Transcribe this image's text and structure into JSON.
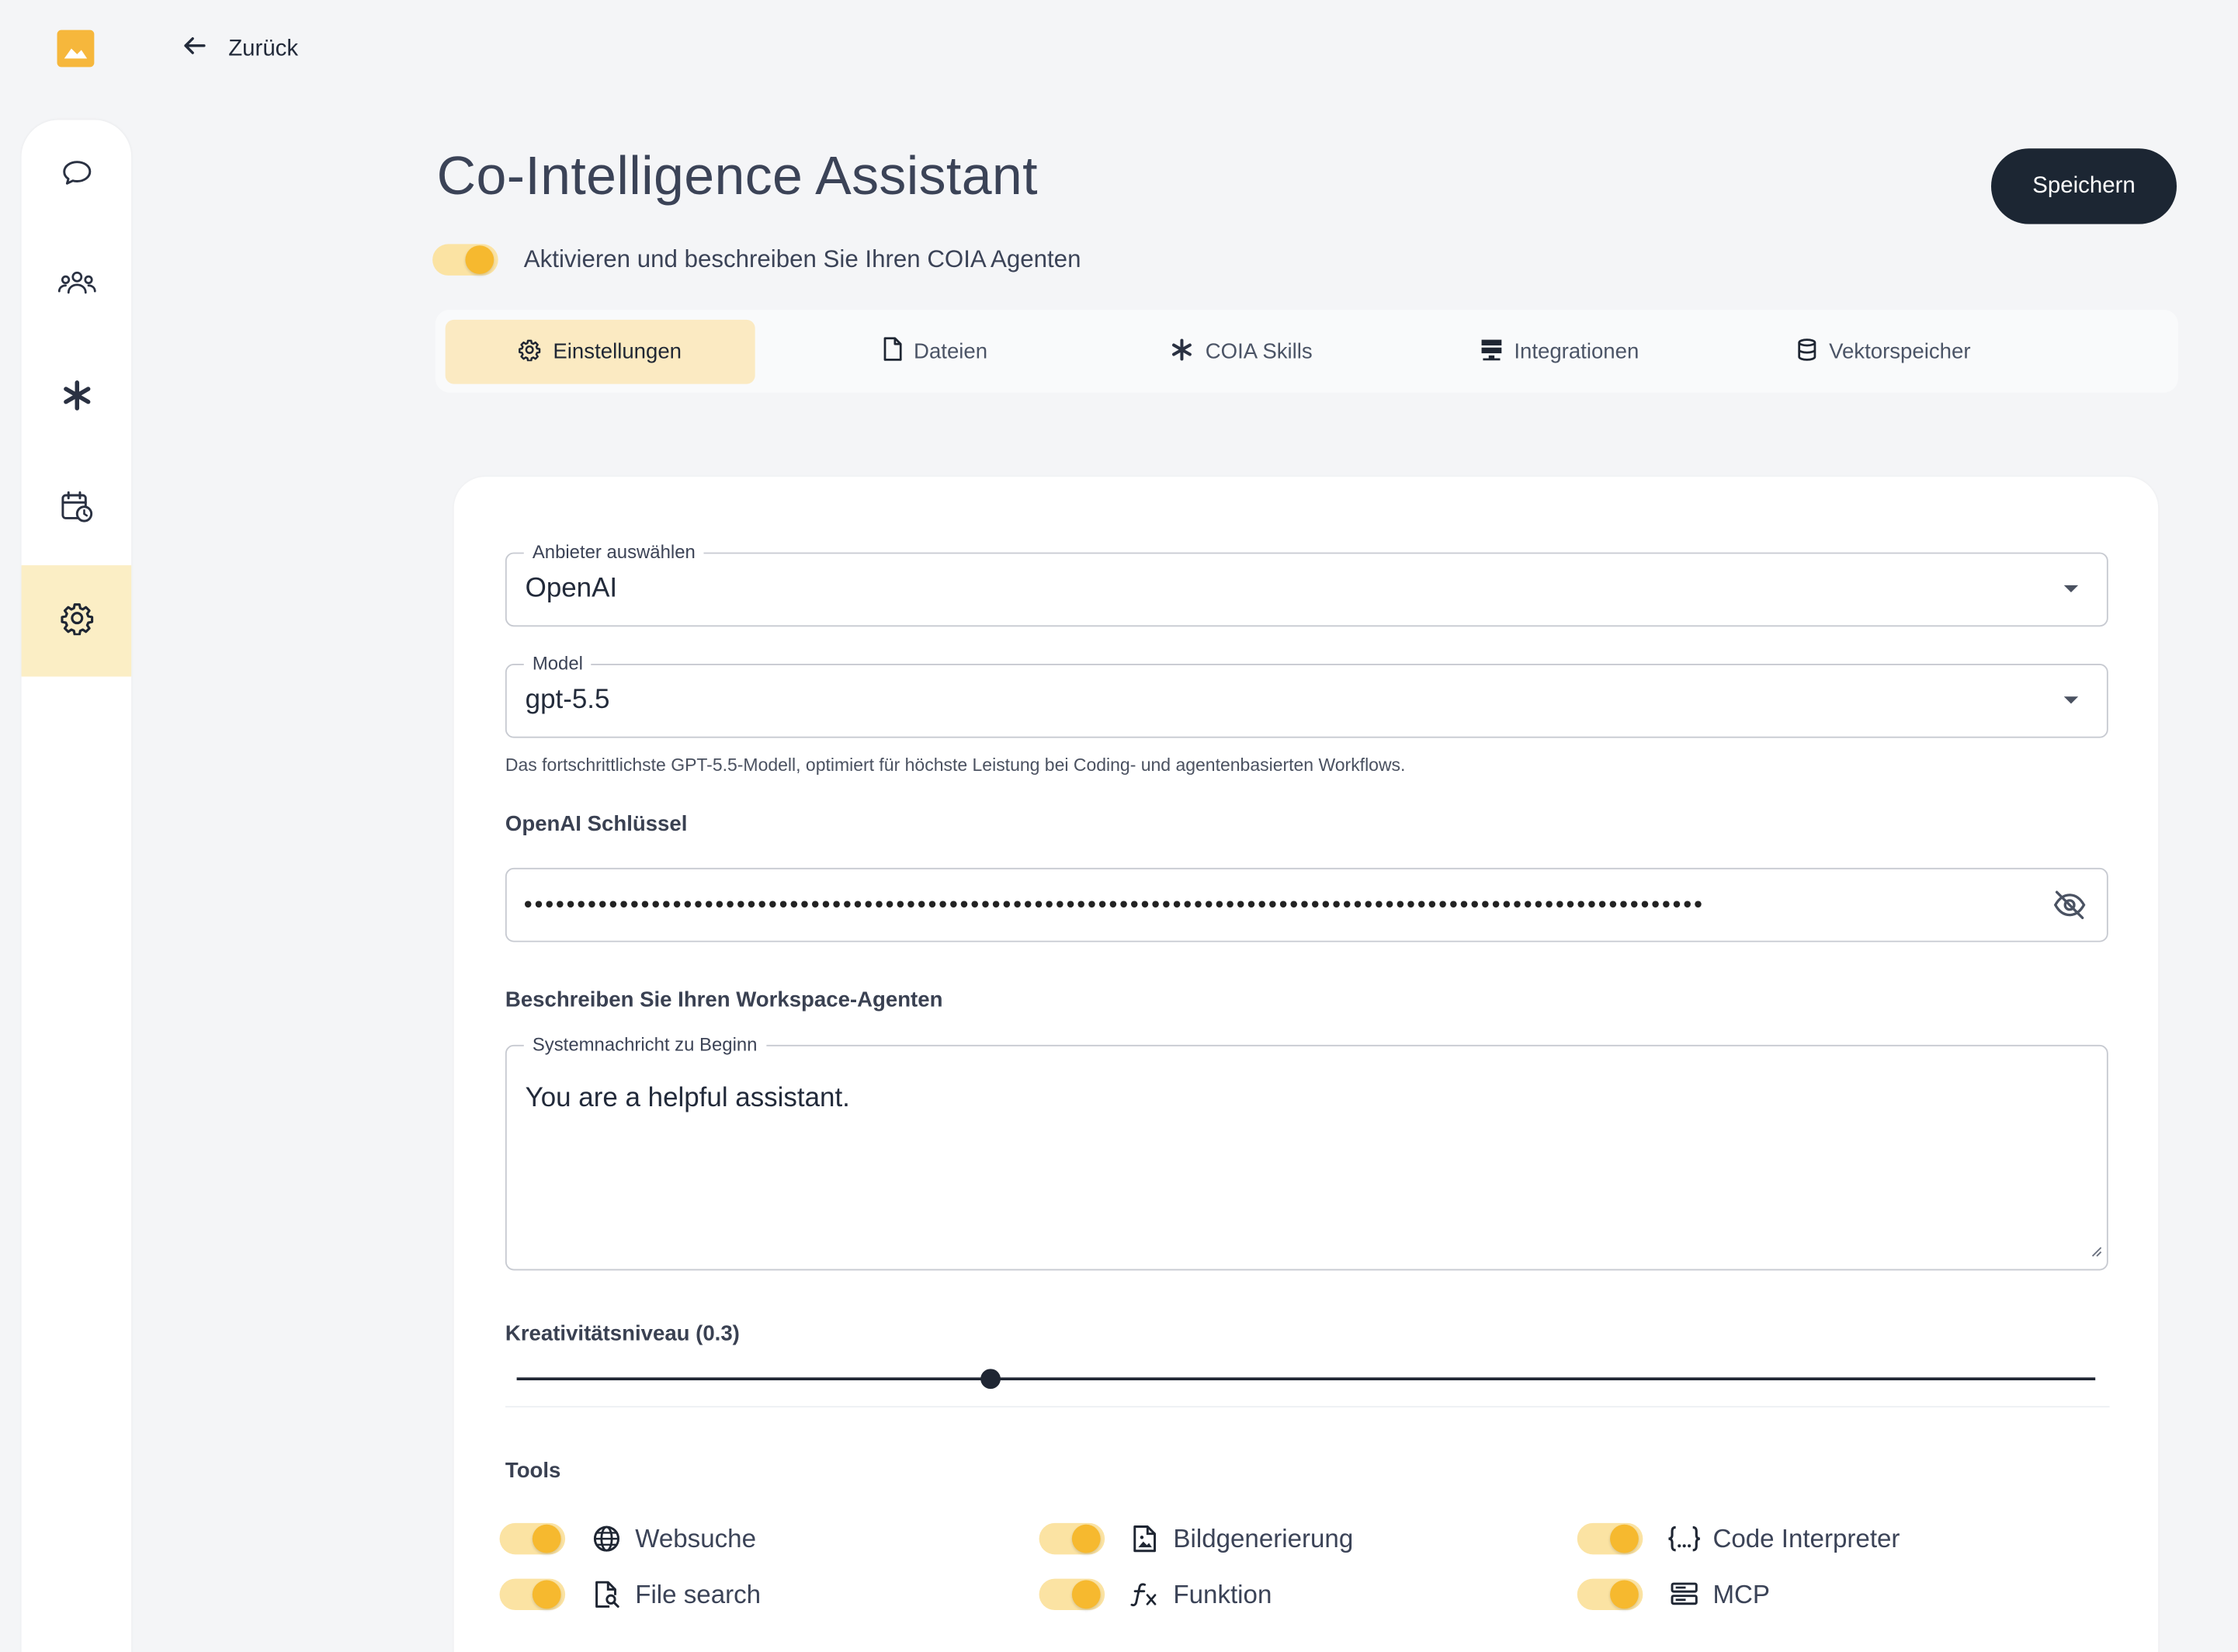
{
  "nav": {
    "back_label": "Zurück"
  },
  "sidebar": {
    "items": [
      {
        "name": "chat",
        "icon": "chat-bubble-icon"
      },
      {
        "name": "users",
        "icon": "users-icon"
      },
      {
        "name": "skills",
        "icon": "asterisk-icon"
      },
      {
        "name": "schedule",
        "icon": "calendar-clock-icon"
      },
      {
        "name": "settings",
        "icon": "gear-icon",
        "active": true
      }
    ]
  },
  "header": {
    "title": "Co-Intelligence Assistant",
    "save_label": "Speichern",
    "activate_label": "Aktivieren und beschreiben Sie Ihren COIA Agenten",
    "activate_enabled": true
  },
  "tabs": [
    {
      "label": "Einstellungen",
      "icon": "gear-icon",
      "active": true
    },
    {
      "label": "Dateien",
      "icon": "file-icon"
    },
    {
      "label": "COIA Skills",
      "icon": "asterisk-icon"
    },
    {
      "label": "Integrationen",
      "icon": "server-icon"
    },
    {
      "label": "Vektorspeicher",
      "icon": "database-icon"
    }
  ],
  "form": {
    "provider": {
      "label": "Anbieter auswählen",
      "value": "OpenAI"
    },
    "model": {
      "label": "Model",
      "value": "gpt-5.5",
      "helper": "Das fortschrittlichste GPT-5.5-Modell, optimiert für höchste Leistung bei Coding- und agentenbasierten Workflows."
    },
    "api_key": {
      "label": "OpenAI Schlüssel",
      "masked_value": "•••••••••••••••••••••••••••••••••••••••••••••••••••••••••••••••••••••••••••••••••••••••••••••••••••••••••••••••"
    },
    "description": {
      "section_label": "Beschreiben Sie Ihren Workspace-Agenten",
      "label": "Systemnachricht zu Beginn",
      "value": "You are a helpful assistant."
    },
    "creativity": {
      "label": "Kreativitätsniveau (0.3)",
      "value": 0.3
    }
  },
  "tools": {
    "label": "Tools",
    "items": [
      {
        "label": "Websuche",
        "icon": "globe-icon",
        "enabled": true
      },
      {
        "label": "Bildgenerierung",
        "icon": "image-file-icon",
        "enabled": true
      },
      {
        "label": "Code Interpreter",
        "icon": "code-braces-icon",
        "enabled": true
      },
      {
        "label": "File search",
        "icon": "file-search-icon",
        "enabled": true
      },
      {
        "label": "Funktion",
        "icon": "function-icon",
        "enabled": true
      },
      {
        "label": "MCP",
        "icon": "server-icon",
        "enabled": true
      }
    ]
  },
  "colors": {
    "accent": "#f6b92f",
    "accent_light": "#fbe3a3",
    "active_bg": "#fbeec5",
    "dark": "#1c2633",
    "background": "#f4f5f7"
  }
}
